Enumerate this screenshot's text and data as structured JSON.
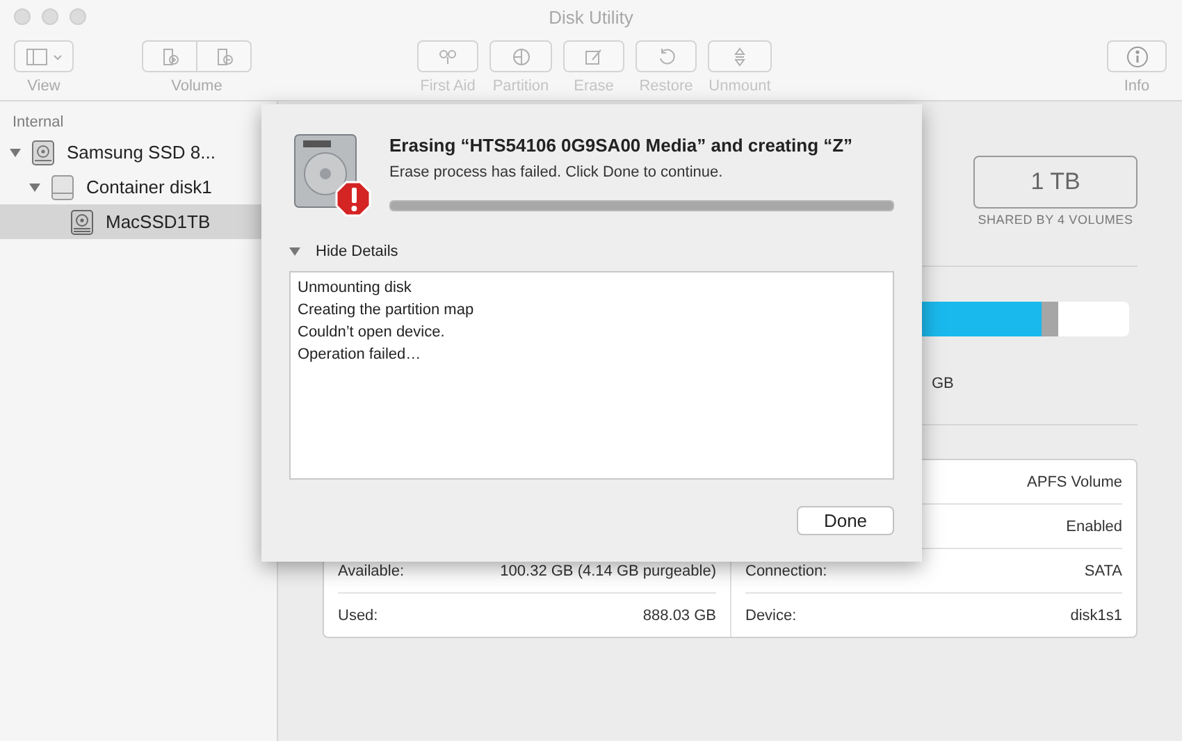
{
  "window": {
    "title": "Disk Utility"
  },
  "toolbar": [
    {
      "label": "View",
      "kind": "view",
      "disabled": false
    },
    {
      "label": "Volume",
      "kind": "volume",
      "disabled": false
    },
    {
      "label": "First Aid",
      "kind": "firstaid",
      "disabled": true
    },
    {
      "label": "Partition",
      "kind": "partition",
      "disabled": true
    },
    {
      "label": "Erase",
      "kind": "erase",
      "disabled": true
    },
    {
      "label": "Restore",
      "kind": "restore",
      "disabled": true
    },
    {
      "label": "Unmount",
      "kind": "unmount",
      "disabled": true
    },
    {
      "label": "Info",
      "kind": "info",
      "disabled": false
    }
  ],
  "sidebar": {
    "section": "Internal",
    "items": [
      {
        "label": "Samsung SSD 8...",
        "kind": "disk",
        "expanded": true,
        "selected": false,
        "children": [
          {
            "label": "Container disk1",
            "kind": "container",
            "expanded": true,
            "selected": false,
            "children": [
              {
                "label": "MacSSD1TB",
                "kind": "volume",
                "selected": true
              }
            ]
          }
        ]
      }
    ]
  },
  "capacity": {
    "value": "1 TB",
    "caption": "SHARED BY 4 VOLUMES"
  },
  "usage": {
    "level": 0.89,
    "value_fragment": "GB"
  },
  "info": {
    "left": [
      {
        "label": "Available:",
        "value": "100.32 GB (4.14 GB purgeable)"
      },
      {
        "label": "Used:",
        "value": "888.03 GB"
      }
    ],
    "right": [
      {
        "value": "APFS Volume"
      },
      {
        "value": "Enabled"
      },
      {
        "label": "Connection:",
        "value": "SATA"
      },
      {
        "label": "Device:",
        "value": "disk1s1"
      }
    ]
  },
  "dialog": {
    "title": "Erasing “HTS54106 0G9SA00 Media” and creating “Z”",
    "message": "Erase process has failed. Click Done to continue.",
    "progress": {
      "level": 1
    },
    "details_toggle": "Hide Details",
    "details_expanded": true,
    "log": [
      "Unmounting disk",
      "Creating the partition map",
      "Couldn’t open device.",
      "Operation failed…"
    ],
    "button": "Done"
  }
}
